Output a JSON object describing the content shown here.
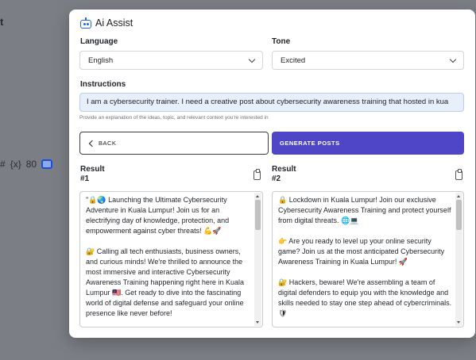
{
  "background": {
    "partial_title": "t",
    "toolbar_icons": [
      "#",
      "{x}",
      "80"
    ]
  },
  "modal": {
    "title": "Ai Assist",
    "language": {
      "label": "Language",
      "value": "English"
    },
    "tone": {
      "label": "Tone",
      "value": "Excited"
    },
    "instructions": {
      "label": "Instructions",
      "value": "I am a cybersecurity trainer. I need a creative post about cybersecurity awareness training that hosted in kua",
      "helper": "Provide an explanation of the ideas, topic, and relevant context you're interested in"
    },
    "buttons": {
      "back": "BACK",
      "generate": "GENERATE POSTS"
    },
    "results": [
      {
        "label": "Result",
        "number": "#1",
        "paragraphs": [
          "\"🔒🌏 Launching the Ultimate Cybersecurity Adventure in Kuala Lumpur! Join us for an electrifying day of knowledge, protection, and empowerment against cyber threats! 💪🚀",
          "🔐 Calling all tech enthusiasts, business owners, and curious minds! We're thrilled to announce the most immersive and interactive Cybersecurity Awareness Training happening right here in Kuala Lumpur 🇲🇾. Get ready to dive into the fascinating world of digital defense and safeguard your online presence like never before!"
        ]
      },
      {
        "label": "Result",
        "number": "#2",
        "paragraphs": [
          "🔒 Lockdown in Kuala Lumpur! Join our exclusive Cybersecurity Awareness Training and protect yourself from digital threats. 🌐💻",
          "👉 Are you ready to level up your online security game? Join us at the most anticipated Cybersecurity Awareness Training in Kuala Lumpur! 🚀",
          "🔐 Hackers, beware! We're assembling a team of digital defenders to equip you with the knowledge and skills needed to stay one step ahead of cybercriminals. 🛡"
        ]
      }
    ]
  },
  "colors": {
    "accent": "#4f46c7",
    "input_bg": "#e7effb",
    "overlay": "#7b7e84"
  }
}
